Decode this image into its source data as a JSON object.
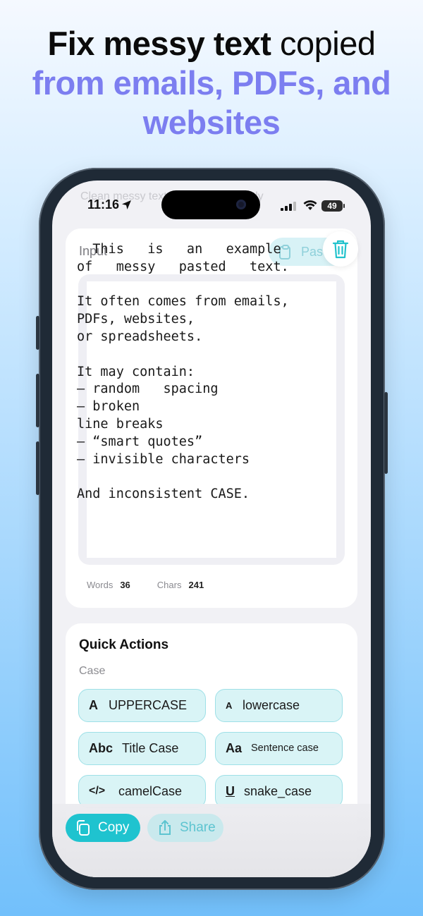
{
  "headline": {
    "part1": "Fix messy text",
    "part2": " copied",
    "line2": "from emails, PDFs, and",
    "line3": "websites"
  },
  "status_bar": {
    "time": "11:16",
    "battery": "49"
  },
  "ghost_text": "Clean messy text & fix case instantly",
  "input": {
    "title": "Input",
    "paste_label": "Paste",
    "text": "  This   is   an   example\nof   messy   pasted   text.\n\nIt often comes from emails,\nPDFs, websites,\nor spreadsheets.\n\nIt may contain:\n— random   spacing\n— broken\nline breaks\n— “smart quotes”\n— invisible characters\n\nAnd inconsistent CASE.",
    "words_label": "Words",
    "words_value": "36",
    "chars_label": "Chars",
    "chars_value": "241"
  },
  "quick_actions": {
    "title": "Quick Actions",
    "section": "Case",
    "buttons": [
      {
        "glyph": "A",
        "label": "UPPERCASE"
      },
      {
        "glyph": "A",
        "label": "lowercase"
      },
      {
        "glyph": "Abc",
        "label": "Title Case"
      },
      {
        "glyph": "Aa",
        "label": "Sentence case"
      },
      {
        "glyph": "</>",
        "label": "camelCase"
      },
      {
        "glyph": "U",
        "label": "snake_case"
      }
    ]
  },
  "bottom": {
    "copy_label": "Copy",
    "share_label": "Share"
  },
  "colors": {
    "accent": "#1fc3cf",
    "headline_accent": "#7c7ef0"
  }
}
